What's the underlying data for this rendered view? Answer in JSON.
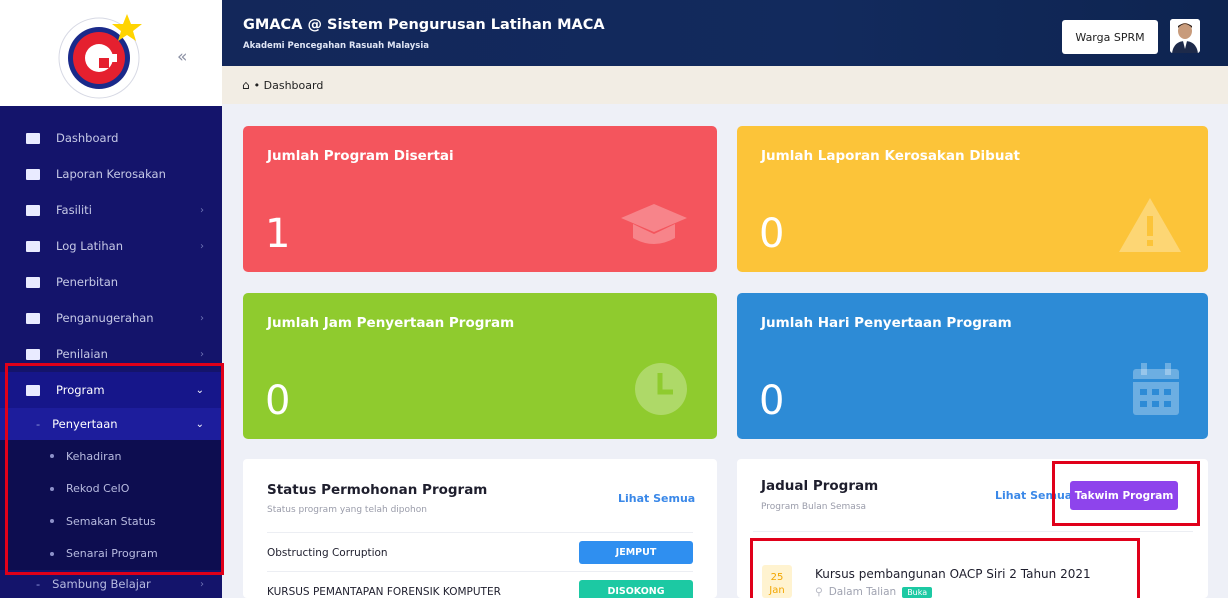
{
  "header": {
    "title": "GMACA @ Sistem Pengurusan Latihan MACA",
    "subtitle": "Akademi Pencegahan Rasuah Malaysia",
    "user_button": "Warga SPRM"
  },
  "breadcrumb": {
    "current": "Dashboard"
  },
  "sidebar": {
    "collapse_glyph": "«",
    "items": [
      {
        "label": "Dashboard",
        "icon": "dashboard-icon",
        "chevron": false
      },
      {
        "label": "Laporan Kerosakan",
        "icon": "report-icon",
        "chevron": false
      },
      {
        "label": "Fasiliti",
        "icon": "building-icon",
        "chevron": true
      },
      {
        "label": "Log Latihan",
        "icon": "folder-icon",
        "chevron": true
      },
      {
        "label": "Penerbitan",
        "icon": "folder-icon",
        "chevron": false
      },
      {
        "label": "Penganugerahan",
        "icon": "users-icon",
        "chevron": true
      },
      {
        "label": "Penilaian",
        "icon": "folder-icon",
        "chevron": true
      },
      {
        "label": "Program",
        "icon": "file-icon",
        "chevron": true,
        "expanded": true
      }
    ],
    "program_sub": {
      "label": "Penyertaan",
      "expanded": true
    },
    "penyertaan_items": [
      "Kehadiran",
      "Rekod CeIO",
      "Semakan Status",
      "Senarai Program"
    ],
    "next_sub": "Sambung Belajar"
  },
  "stats": [
    {
      "label": "Jumlah Program Disertai",
      "value": "1",
      "color": "#f4555d",
      "icon": "graduation-cap-icon"
    },
    {
      "label": "Jumlah Laporan Kerosakan Dibuat",
      "value": "0",
      "color": "#fcc439",
      "icon": "warning-icon"
    },
    {
      "label": "Jumlah Jam Penyertaan Program",
      "value": "0",
      "color": "#8fcb2e",
      "icon": "clock-icon"
    },
    {
      "label": "Jumlah Hari Penyertaan Program",
      "value": "0",
      "color": "#2d8bd6",
      "icon": "calendar-icon"
    }
  ],
  "status_panel": {
    "title": "Status Permohonan Program",
    "subtitle": "Status program yang telah dipohon",
    "link": "Lihat Semua",
    "rows": [
      {
        "name": "Obstructing Corruption",
        "status": "JEMPUT",
        "color": "#2f8ff0"
      },
      {
        "name": "KURSUS PEMANTAPAN FORENSIK KOMPUTER",
        "status": "DISOKONG",
        "color": "#1cc9a3"
      }
    ]
  },
  "schedule_panel": {
    "title": "Jadual Program",
    "subtitle": "Program Bulan Semasa",
    "link": "Lihat Semua",
    "button": "Takwim Program",
    "event": {
      "day": "25",
      "month": "Jan",
      "title": "Kursus pembangunan OACP Siri 2 Tahun 2021",
      "location": "Dalam Talian",
      "tag": "Buka"
    }
  }
}
